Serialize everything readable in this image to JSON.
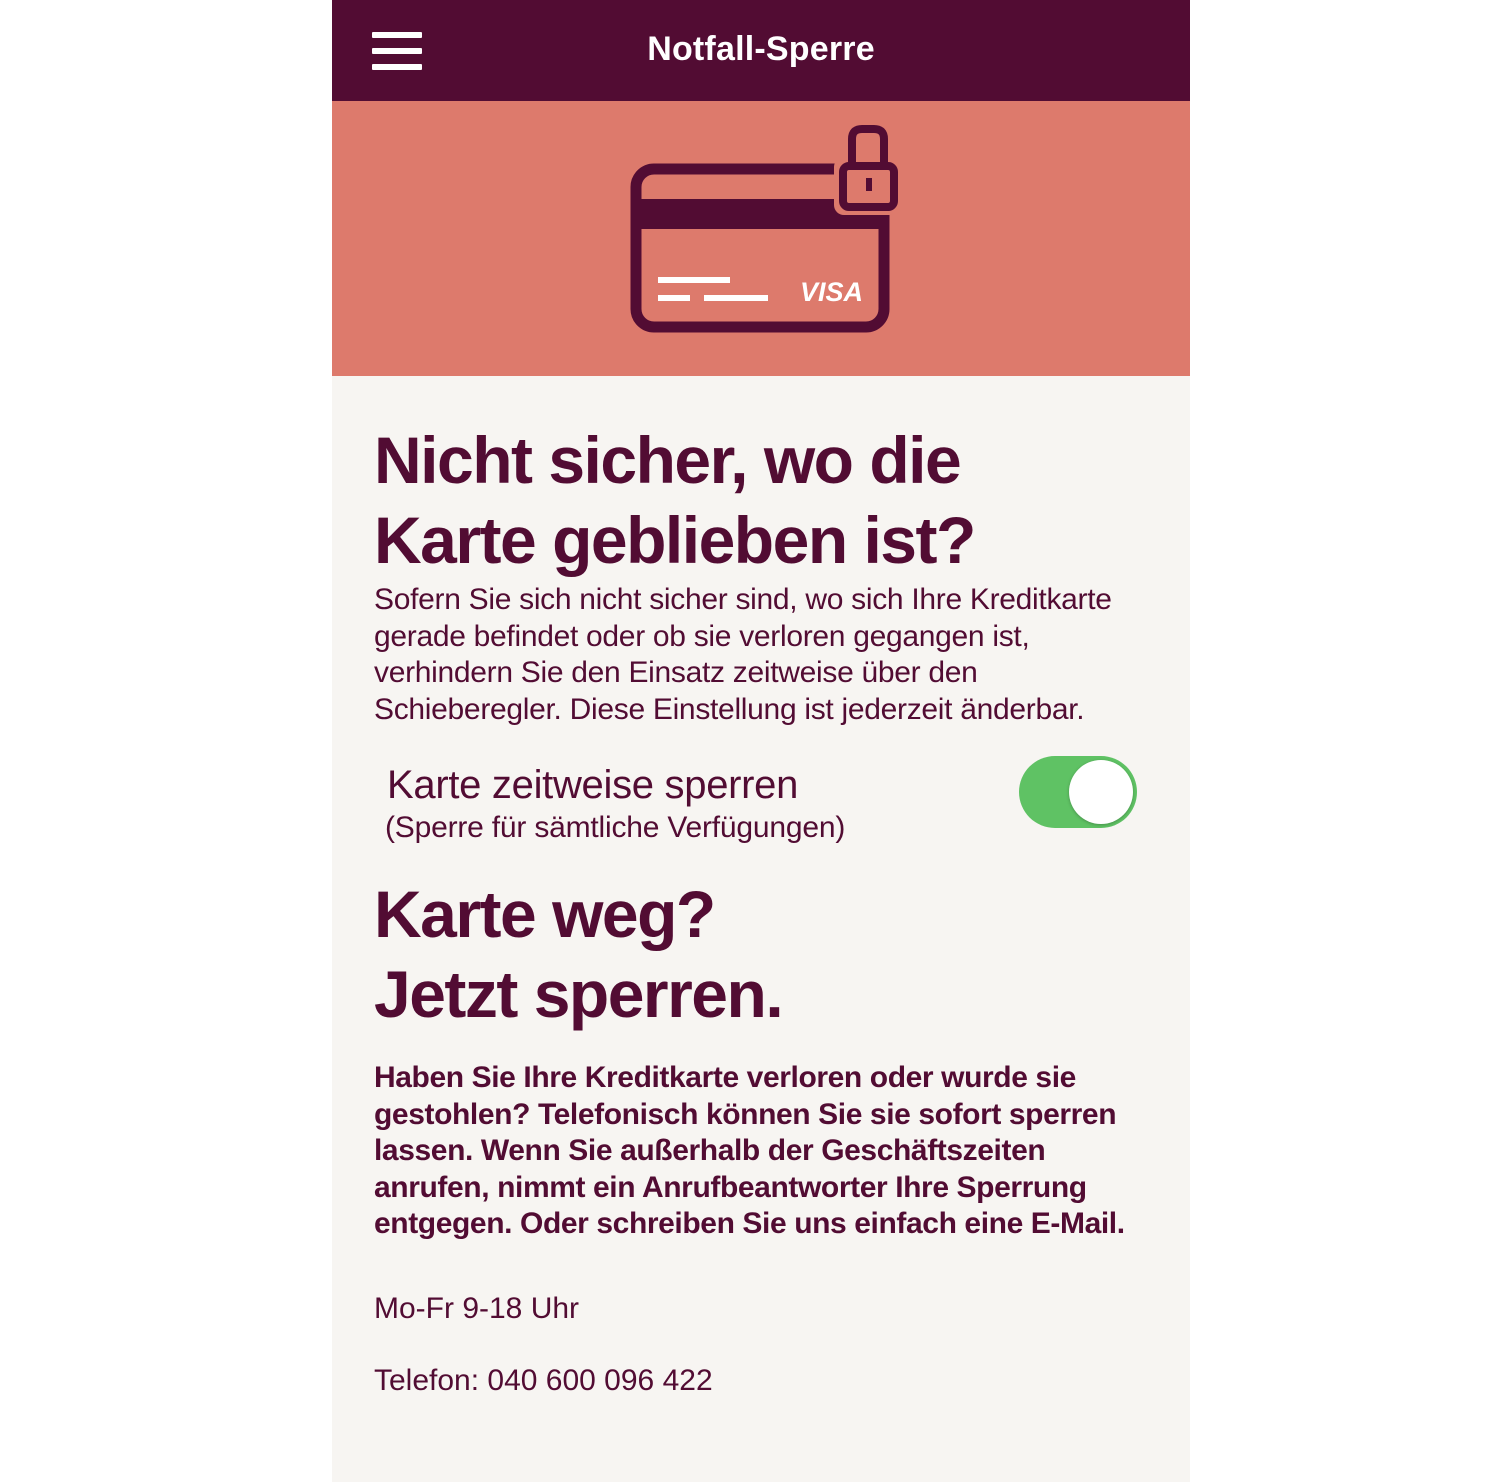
{
  "header": {
    "title": "Notfall-Sperre",
    "menu_icon": "hamburger-menu-icon"
  },
  "hero": {
    "icon": "locked-credit-card-icon",
    "card_brand": "VISA"
  },
  "section_temporary": {
    "heading": "Nicht sicher, wo die\nKarte geblieben ist?",
    "text": "Sofern Sie sich nicht sicher sind, wo sich Ihre Kreditkarte gerade befindet oder ob sie verloren gegangen ist, verhindern Sie den Einsatz zeitweise über den Schieberegler. Diese Einstellung ist jederzeit änderbar.",
    "toggle": {
      "label": "Karte zeitweise sperren",
      "sublabel": "(Sperre für sämtliche Verfügungen)",
      "state": "on"
    }
  },
  "section_lost": {
    "heading": "Karte weg?\nJetzt sperren.",
    "text": "Haben Sie Ihre Kreditkarte verloren oder wurde sie gestohlen? Telefonisch können Sie sie sofort sperren lassen. Wenn Sie außerhalb der Geschäftszeiten anrufen, nimmt ein Anrufbeantworter Ihre Sperrung entgegen. Oder schreiben Sie uns einfach eine E-Mail.",
    "hours": "Mo-Fr 9-18 Uhr",
    "phone": "Telefon: 040 600 096 422"
  },
  "colors": {
    "brand": "#520c33",
    "hero_bg": "#dd7a6c",
    "page_bg": "#f7f5f2",
    "toggle_on": "#5fc264"
  }
}
